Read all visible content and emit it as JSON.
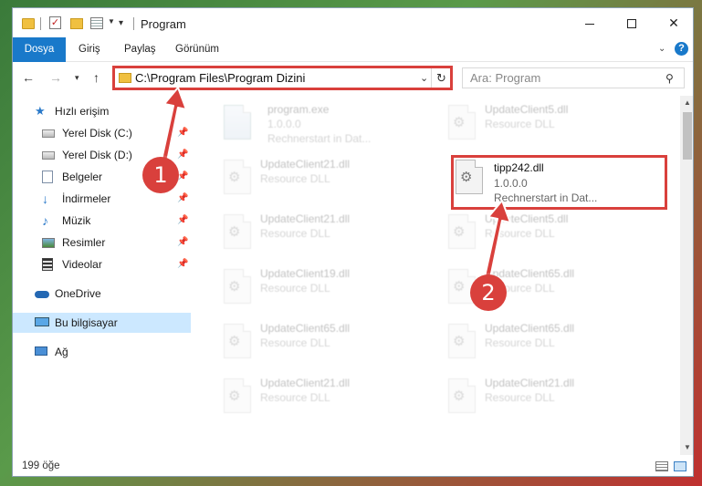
{
  "window": {
    "title": "Program",
    "buttons": {
      "minimize": "minimize",
      "maximize": "maximize",
      "close": "✕"
    }
  },
  "ribbon": {
    "tabs": [
      "Dosya",
      "Giriş",
      "Paylaş",
      "Görünüm"
    ],
    "help": "?"
  },
  "navigation": {
    "address_path": "C:\\Program Files\\Program Dizini",
    "search_placeholder": "Ara: Program"
  },
  "sidebar": {
    "items": [
      {
        "label": "Hızlı erişim",
        "icon": "star-icon",
        "pinned": false
      },
      {
        "label": "Yerel Disk (C:)",
        "icon": "drive-icon",
        "pinned": true
      },
      {
        "label": "Yerel Disk (D:)",
        "icon": "drive-icon",
        "pinned": true
      },
      {
        "label": "Belgeler",
        "icon": "documents-icon",
        "pinned": true
      },
      {
        "label": "İndirmeler",
        "icon": "download-icon",
        "pinned": true
      },
      {
        "label": "Müzik",
        "icon": "music-icon",
        "pinned": true
      },
      {
        "label": "Resimler",
        "icon": "pictures-icon",
        "pinned": true
      },
      {
        "label": "Videolar",
        "icon": "videos-icon",
        "pinned": true
      },
      {
        "label": "OneDrive",
        "icon": "cloud-icon",
        "pinned": false
      },
      {
        "label": "Bu bilgisayar",
        "icon": "computer-icon",
        "pinned": false,
        "selected": true
      },
      {
        "label": "Ağ",
        "icon": "network-icon",
        "pinned": false
      }
    ]
  },
  "files": [
    {
      "name": "program.exe",
      "line2": "1.0.0.0",
      "line3": "Rechnerstart in Dat...",
      "type": "exe"
    },
    {
      "name": "UpdateClient5.dll",
      "line2": "Resource DLL",
      "line3": ""
    },
    {
      "name": "UpdateClient21.dll",
      "line2": "Resource DLL",
      "line3": ""
    },
    {
      "name": "tipp242.dll",
      "line2": "1.0.0.0",
      "line3": "Rechnerstart in Dat...",
      "highlighted": true
    },
    {
      "name": "UpdateClient21.dll",
      "line2": "Resource DLL",
      "line3": ""
    },
    {
      "name": "UpdateClient5.dll",
      "line2": "Resource DLL",
      "line3": ""
    },
    {
      "name": "UpdateClient19.dll",
      "line2": "Resource DLL",
      "line3": ""
    },
    {
      "name": "UpdateClient65.dll",
      "line2": "Resource DLL",
      "line3": ""
    },
    {
      "name": "UpdateClient65.dll",
      "line2": "Resource DLL",
      "line3": ""
    },
    {
      "name": "UpdateClient65.dll",
      "line2": "Resource DLL",
      "line3": ""
    },
    {
      "name": "UpdateClient21.dll",
      "line2": "Resource DLL",
      "line3": ""
    },
    {
      "name": "UpdateClient21.dll",
      "line2": "Resource DLL",
      "line3": ""
    }
  ],
  "status": {
    "item_count": "199 öğe"
  },
  "annotations": {
    "step1": "1",
    "step2": "2",
    "color": "#d9403c"
  }
}
